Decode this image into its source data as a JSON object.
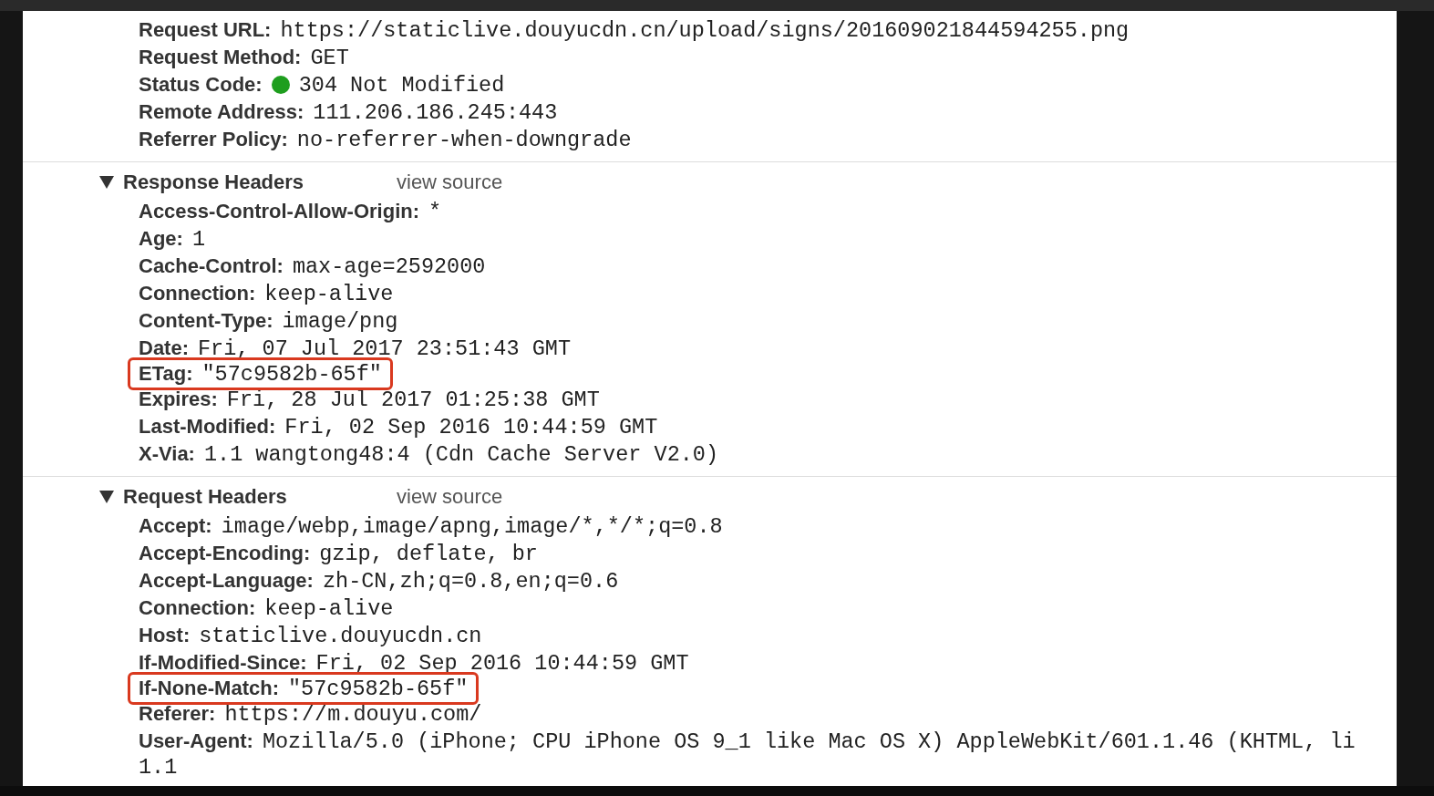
{
  "general": [
    {
      "key": "Request URL:",
      "value": "https://staticlive.douyucdn.cn/upload/signs/201609021844594255.png",
      "kind": "plain"
    },
    {
      "key": "Request Method:",
      "value": "GET",
      "kind": "plain"
    },
    {
      "key": "Status Code:",
      "value": "304 Not Modified",
      "kind": "status",
      "color": "#1e9e1e"
    },
    {
      "key": "Remote Address:",
      "value": "111.206.186.245:443",
      "kind": "plain"
    },
    {
      "key": "Referrer Policy:",
      "value": "no-referrer-when-downgrade",
      "kind": "plain"
    }
  ],
  "sections": [
    {
      "title": "Response Headers",
      "link": "view source",
      "expanded": true,
      "rows": [
        {
          "key": "Access-Control-Allow-Origin:",
          "value": "*",
          "highlighted": false
        },
        {
          "key": "Age:",
          "value": "1",
          "highlighted": false
        },
        {
          "key": "Cache-Control:",
          "value": "max-age=2592000",
          "highlighted": false
        },
        {
          "key": "Connection:",
          "value": "keep-alive",
          "highlighted": false
        },
        {
          "key": "Content-Type:",
          "value": "image/png",
          "highlighted": false
        },
        {
          "key": "Date:",
          "value": "Fri, 07 Jul 2017 23:51:43 GMT",
          "highlighted": false
        },
        {
          "key": "ETag:",
          "value": "\"57c9582b-65f\"",
          "highlighted": true
        },
        {
          "key": "Expires:",
          "value": "Fri, 28 Jul 2017 01:25:38 GMT",
          "highlighted": false
        },
        {
          "key": "Last-Modified:",
          "value": "Fri, 02 Sep 2016 10:44:59 GMT",
          "highlighted": false
        },
        {
          "key": "X-Via:",
          "value": "1.1 wangtong48:4 (Cdn Cache Server V2.0)",
          "highlighted": false
        }
      ]
    },
    {
      "title": "Request Headers",
      "link": "view source",
      "expanded": true,
      "rows": [
        {
          "key": "Accept:",
          "value": "image/webp,image/apng,image/*,*/*;q=0.8",
          "highlighted": false
        },
        {
          "key": "Accept-Encoding:",
          "value": "gzip, deflate, br",
          "highlighted": false
        },
        {
          "key": "Accept-Language:",
          "value": "zh-CN,zh;q=0.8,en;q=0.6",
          "highlighted": false
        },
        {
          "key": "Connection:",
          "value": "keep-alive",
          "highlighted": false
        },
        {
          "key": "Host:",
          "value": "staticlive.douyucdn.cn",
          "highlighted": false
        },
        {
          "key": "If-Modified-Since:",
          "value": "Fri, 02 Sep 2016 10:44:59 GMT",
          "highlighted": false
        },
        {
          "key": "If-None-Match:",
          "value": "\"57c9582b-65f\"",
          "highlighted": true
        },
        {
          "key": "Referer:",
          "value": "https://m.douyu.com/",
          "highlighted": false
        },
        {
          "key": "User-Agent:",
          "value": "Mozilla/5.0 (iPhone; CPU iPhone OS 9_1 like Mac OS X) AppleWebKit/601.1.46 (KHTML, li",
          "continuation": "1.1",
          "highlighted": false
        }
      ]
    }
  ]
}
